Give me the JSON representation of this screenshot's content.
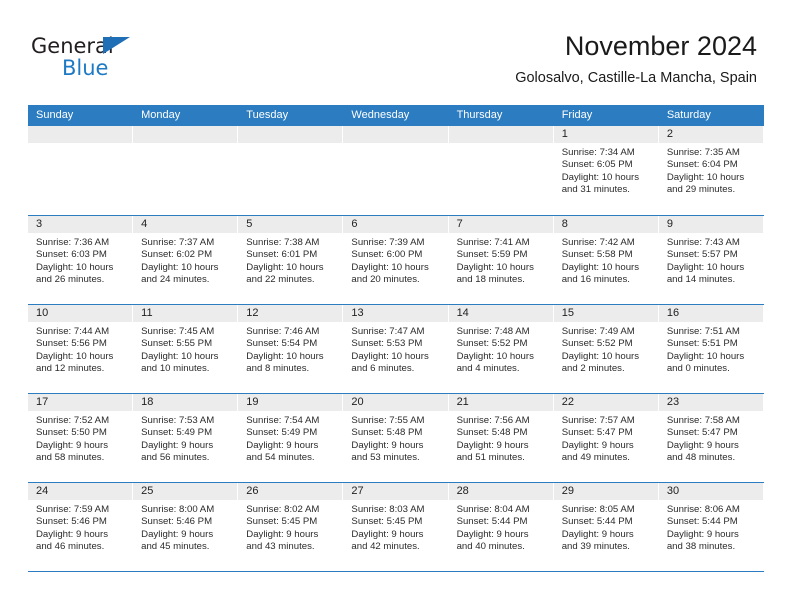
{
  "brand": {
    "name_dark": "General",
    "name_blue": "Blue",
    "accent_blue": "#1f7ac4",
    "triangle_blue": "#1f6fb6"
  },
  "header": {
    "title": "November 2024",
    "subtitle": "Golosalvo, Castille-La Mancha, Spain"
  },
  "theme": {
    "header_row_bg": "#2b7cc0",
    "day_number_bg": "#ececec",
    "grid_line": "#2b7cc0",
    "text": "#2b2b2b"
  },
  "calendar": {
    "weekday_headers": [
      "Sunday",
      "Monday",
      "Tuesday",
      "Wednesday",
      "Thursday",
      "Friday",
      "Saturday"
    ],
    "weeks": [
      [
        {
          "day": "",
          "sunrise": "",
          "sunset": "",
          "daylight_line1": "",
          "daylight_line2": "",
          "empty": true
        },
        {
          "day": "",
          "sunrise": "",
          "sunset": "",
          "daylight_line1": "",
          "daylight_line2": "",
          "empty": true
        },
        {
          "day": "",
          "sunrise": "",
          "sunset": "",
          "daylight_line1": "",
          "daylight_line2": "",
          "empty": true
        },
        {
          "day": "",
          "sunrise": "",
          "sunset": "",
          "daylight_line1": "",
          "daylight_line2": "",
          "empty": true
        },
        {
          "day": "",
          "sunrise": "",
          "sunset": "",
          "daylight_line1": "",
          "daylight_line2": "",
          "empty": true
        },
        {
          "day": "1",
          "sunrise": "Sunrise: 7:34 AM",
          "sunset": "Sunset: 6:05 PM",
          "daylight_line1": "Daylight: 10 hours",
          "daylight_line2": "and 31 minutes.",
          "empty": false
        },
        {
          "day": "2",
          "sunrise": "Sunrise: 7:35 AM",
          "sunset": "Sunset: 6:04 PM",
          "daylight_line1": "Daylight: 10 hours",
          "daylight_line2": "and 29 minutes.",
          "empty": false
        }
      ],
      [
        {
          "day": "3",
          "sunrise": "Sunrise: 7:36 AM",
          "sunset": "Sunset: 6:03 PM",
          "daylight_line1": "Daylight: 10 hours",
          "daylight_line2": "and 26 minutes.",
          "empty": false
        },
        {
          "day": "4",
          "sunrise": "Sunrise: 7:37 AM",
          "sunset": "Sunset: 6:02 PM",
          "daylight_line1": "Daylight: 10 hours",
          "daylight_line2": "and 24 minutes.",
          "empty": false
        },
        {
          "day": "5",
          "sunrise": "Sunrise: 7:38 AM",
          "sunset": "Sunset: 6:01 PM",
          "daylight_line1": "Daylight: 10 hours",
          "daylight_line2": "and 22 minutes.",
          "empty": false
        },
        {
          "day": "6",
          "sunrise": "Sunrise: 7:39 AM",
          "sunset": "Sunset: 6:00 PM",
          "daylight_line1": "Daylight: 10 hours",
          "daylight_line2": "and 20 minutes.",
          "empty": false
        },
        {
          "day": "7",
          "sunrise": "Sunrise: 7:41 AM",
          "sunset": "Sunset: 5:59 PM",
          "daylight_line1": "Daylight: 10 hours",
          "daylight_line2": "and 18 minutes.",
          "empty": false
        },
        {
          "day": "8",
          "sunrise": "Sunrise: 7:42 AM",
          "sunset": "Sunset: 5:58 PM",
          "daylight_line1": "Daylight: 10 hours",
          "daylight_line2": "and 16 minutes.",
          "empty": false
        },
        {
          "day": "9",
          "sunrise": "Sunrise: 7:43 AM",
          "sunset": "Sunset: 5:57 PM",
          "daylight_line1": "Daylight: 10 hours",
          "daylight_line2": "and 14 minutes.",
          "empty": false
        }
      ],
      [
        {
          "day": "10",
          "sunrise": "Sunrise: 7:44 AM",
          "sunset": "Sunset: 5:56 PM",
          "daylight_line1": "Daylight: 10 hours",
          "daylight_line2": "and 12 minutes.",
          "empty": false
        },
        {
          "day": "11",
          "sunrise": "Sunrise: 7:45 AM",
          "sunset": "Sunset: 5:55 PM",
          "daylight_line1": "Daylight: 10 hours",
          "daylight_line2": "and 10 minutes.",
          "empty": false
        },
        {
          "day": "12",
          "sunrise": "Sunrise: 7:46 AM",
          "sunset": "Sunset: 5:54 PM",
          "daylight_line1": "Daylight: 10 hours",
          "daylight_line2": "and 8 minutes.",
          "empty": false
        },
        {
          "day": "13",
          "sunrise": "Sunrise: 7:47 AM",
          "sunset": "Sunset: 5:53 PM",
          "daylight_line1": "Daylight: 10 hours",
          "daylight_line2": "and 6 minutes.",
          "empty": false
        },
        {
          "day": "14",
          "sunrise": "Sunrise: 7:48 AM",
          "sunset": "Sunset: 5:52 PM",
          "daylight_line1": "Daylight: 10 hours",
          "daylight_line2": "and 4 minutes.",
          "empty": false
        },
        {
          "day": "15",
          "sunrise": "Sunrise: 7:49 AM",
          "sunset": "Sunset: 5:52 PM",
          "daylight_line1": "Daylight: 10 hours",
          "daylight_line2": "and 2 minutes.",
          "empty": false
        },
        {
          "day": "16",
          "sunrise": "Sunrise: 7:51 AM",
          "sunset": "Sunset: 5:51 PM",
          "daylight_line1": "Daylight: 10 hours",
          "daylight_line2": "and 0 minutes.",
          "empty": false
        }
      ],
      [
        {
          "day": "17",
          "sunrise": "Sunrise: 7:52 AM",
          "sunset": "Sunset: 5:50 PM",
          "daylight_line1": "Daylight: 9 hours",
          "daylight_line2": "and 58 minutes.",
          "empty": false
        },
        {
          "day": "18",
          "sunrise": "Sunrise: 7:53 AM",
          "sunset": "Sunset: 5:49 PM",
          "daylight_line1": "Daylight: 9 hours",
          "daylight_line2": "and 56 minutes.",
          "empty": false
        },
        {
          "day": "19",
          "sunrise": "Sunrise: 7:54 AM",
          "sunset": "Sunset: 5:49 PM",
          "daylight_line1": "Daylight: 9 hours",
          "daylight_line2": "and 54 minutes.",
          "empty": false
        },
        {
          "day": "20",
          "sunrise": "Sunrise: 7:55 AM",
          "sunset": "Sunset: 5:48 PM",
          "daylight_line1": "Daylight: 9 hours",
          "daylight_line2": "and 53 minutes.",
          "empty": false
        },
        {
          "day": "21",
          "sunrise": "Sunrise: 7:56 AM",
          "sunset": "Sunset: 5:48 PM",
          "daylight_line1": "Daylight: 9 hours",
          "daylight_line2": "and 51 minutes.",
          "empty": false
        },
        {
          "day": "22",
          "sunrise": "Sunrise: 7:57 AM",
          "sunset": "Sunset: 5:47 PM",
          "daylight_line1": "Daylight: 9 hours",
          "daylight_line2": "and 49 minutes.",
          "empty": false
        },
        {
          "day": "23",
          "sunrise": "Sunrise: 7:58 AM",
          "sunset": "Sunset: 5:47 PM",
          "daylight_line1": "Daylight: 9 hours",
          "daylight_line2": "and 48 minutes.",
          "empty": false
        }
      ],
      [
        {
          "day": "24",
          "sunrise": "Sunrise: 7:59 AM",
          "sunset": "Sunset: 5:46 PM",
          "daylight_line1": "Daylight: 9 hours",
          "daylight_line2": "and 46 minutes.",
          "empty": false
        },
        {
          "day": "25",
          "sunrise": "Sunrise: 8:00 AM",
          "sunset": "Sunset: 5:46 PM",
          "daylight_line1": "Daylight: 9 hours",
          "daylight_line2": "and 45 minutes.",
          "empty": false
        },
        {
          "day": "26",
          "sunrise": "Sunrise: 8:02 AM",
          "sunset": "Sunset: 5:45 PM",
          "daylight_line1": "Daylight: 9 hours",
          "daylight_line2": "and 43 minutes.",
          "empty": false
        },
        {
          "day": "27",
          "sunrise": "Sunrise: 8:03 AM",
          "sunset": "Sunset: 5:45 PM",
          "daylight_line1": "Daylight: 9 hours",
          "daylight_line2": "and 42 minutes.",
          "empty": false
        },
        {
          "day": "28",
          "sunrise": "Sunrise: 8:04 AM",
          "sunset": "Sunset: 5:44 PM",
          "daylight_line1": "Daylight: 9 hours",
          "daylight_line2": "and 40 minutes.",
          "empty": false
        },
        {
          "day": "29",
          "sunrise": "Sunrise: 8:05 AM",
          "sunset": "Sunset: 5:44 PM",
          "daylight_line1": "Daylight: 9 hours",
          "daylight_line2": "and 39 minutes.",
          "empty": false
        },
        {
          "day": "30",
          "sunrise": "Sunrise: 8:06 AM",
          "sunset": "Sunset: 5:44 PM",
          "daylight_line1": "Daylight: 9 hours",
          "daylight_line2": "and 38 minutes.",
          "empty": false
        }
      ]
    ]
  }
}
